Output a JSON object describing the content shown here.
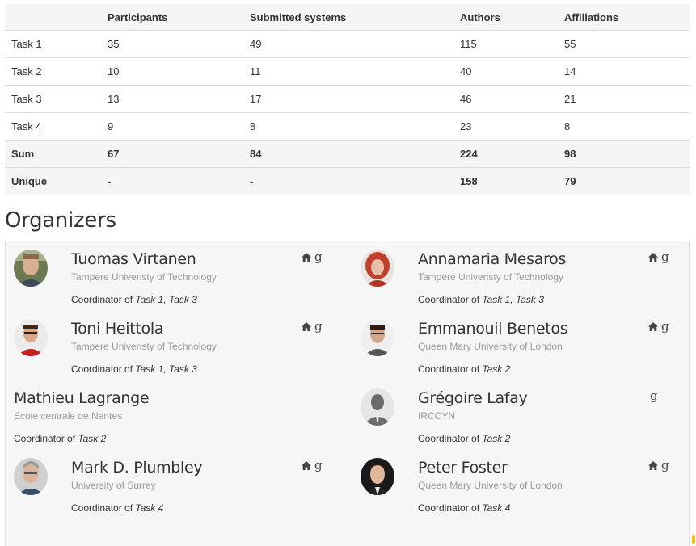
{
  "table": {
    "headers": [
      "",
      "Participants",
      "Submitted systems",
      "Authors",
      "Affiliations"
    ],
    "rows": [
      [
        "Task 1",
        "35",
        "49",
        "115",
        "55"
      ],
      [
        "Task 2",
        "10",
        "11",
        "40",
        "14"
      ],
      [
        "Task 3",
        "13",
        "17",
        "46",
        "21"
      ],
      [
        "Task 4",
        "9",
        "8",
        "23",
        "8"
      ]
    ],
    "totals": [
      [
        "Sum",
        "67",
        "84",
        "224",
        "98"
      ],
      [
        "Unique",
        "-",
        "-",
        "158",
        "79"
      ]
    ]
  },
  "organizers": {
    "heading": "Organizers",
    "coordinator_prefix": "Coordinator of ",
    "people": [
      {
        "name": "Tuomas Virtanen",
        "affiliation": "Tampere Univeristy of Technology",
        "tasks": "Task 1, Task 3",
        "home_link": true,
        "gplus_link": true,
        "avatar": "photo"
      },
      {
        "name": "Annamaria Mesaros",
        "affiliation": "Tampere Univeristy of Technology",
        "tasks": "Task 1, Task 3",
        "home_link": true,
        "gplus_link": true,
        "avatar": "photo"
      },
      {
        "name": "Toni Heittola",
        "affiliation": "Tampere Univeristy of Technology",
        "tasks": "Task 1, Task 3",
        "home_link": true,
        "gplus_link": true,
        "avatar": "photo"
      },
      {
        "name": "Emmanouil Benetos",
        "affiliation": "Queen Mary University of London",
        "tasks": "Task 2",
        "home_link": true,
        "gplus_link": true,
        "avatar": "photo"
      },
      {
        "name": "Mathieu Lagrange",
        "affiliation": "Ecole centrale de Nantes",
        "tasks": "Task 2",
        "home_link": false,
        "gplus_link": false,
        "avatar": "none"
      },
      {
        "name": "Grégoire Lafay",
        "affiliation": "IRCCYN",
        "tasks": "Task 2",
        "home_link": false,
        "gplus_link": true,
        "avatar": "placeholder"
      },
      {
        "name": "Mark D. Plumbley",
        "affiliation": "University of Surrey",
        "tasks": "Task 4",
        "home_link": true,
        "gplus_link": true,
        "avatar": "photo"
      },
      {
        "name": "Peter Foster",
        "affiliation": "Queen Mary University of London",
        "tasks": "Task 4",
        "home_link": true,
        "gplus_link": true,
        "avatar": "photo"
      }
    ]
  },
  "icons": {
    "home": "home-icon",
    "gplus": "google-plus-icon"
  },
  "colors": {
    "table_header_bg": "#f5f5f5",
    "panel_bg": "#f6f6f6",
    "muted_text": "#9a9a9a"
  }
}
